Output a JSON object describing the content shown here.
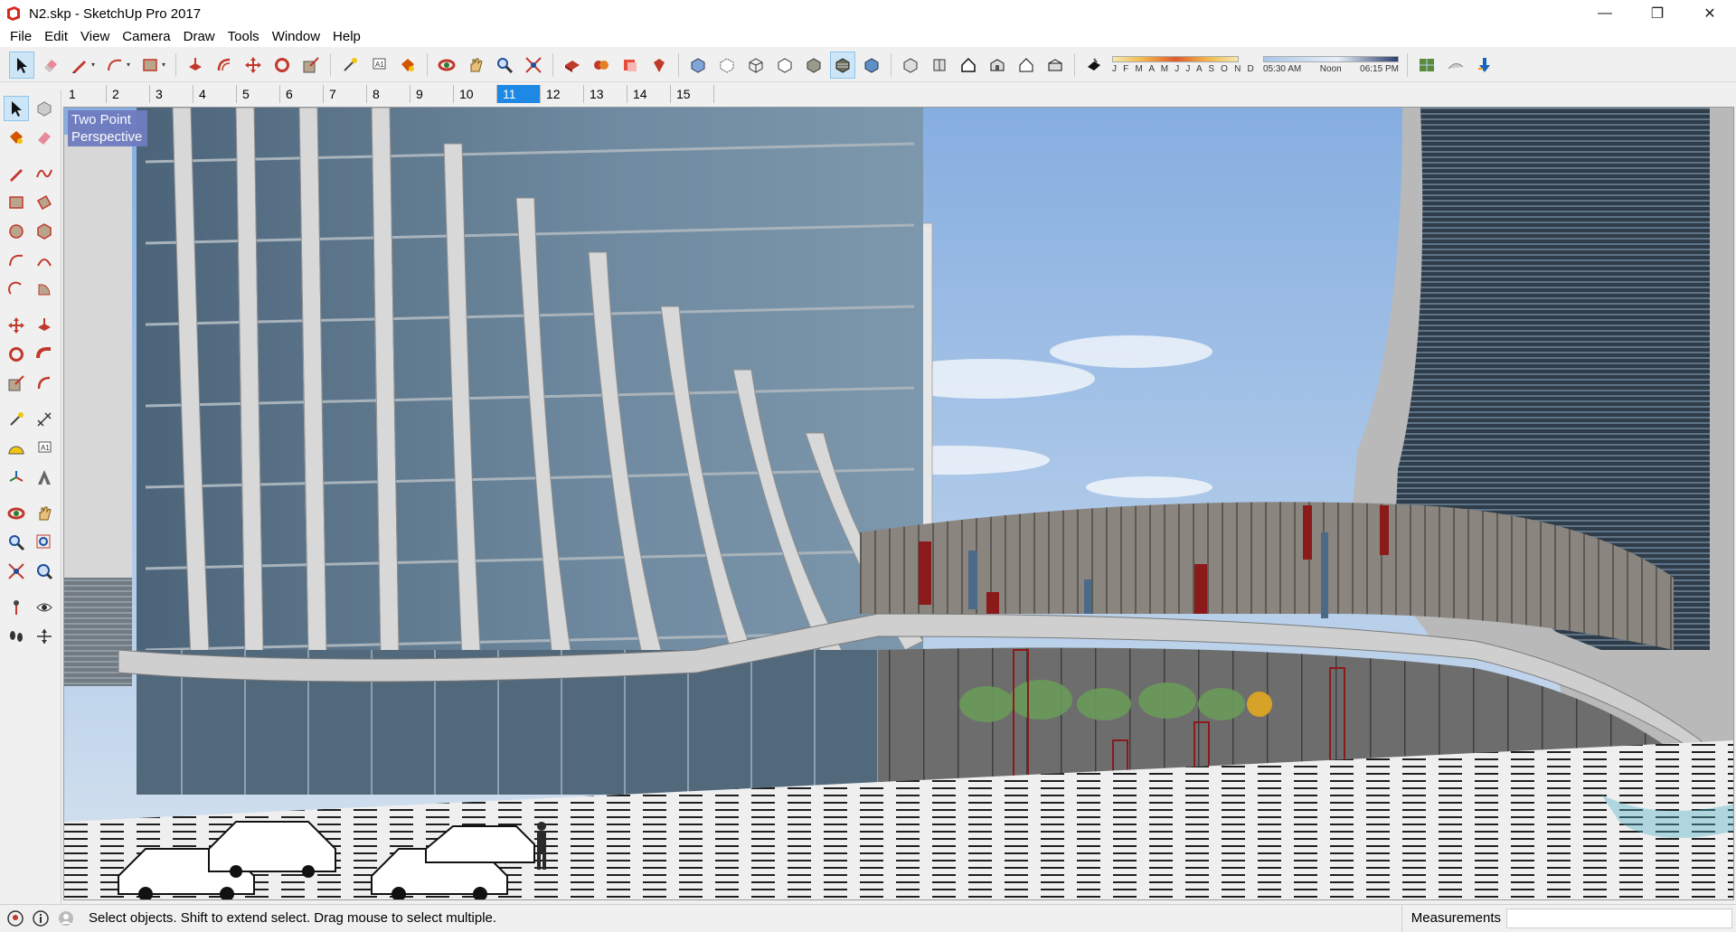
{
  "window": {
    "title": "N2.skp - SketchUp Pro 2017"
  },
  "menu": [
    "File",
    "Edit",
    "View",
    "Camera",
    "Draw",
    "Tools",
    "Window",
    "Help"
  ],
  "shadow": {
    "months_label": "J F M A M J J A S O N D",
    "time_start": "05:30 AM",
    "time_mid": "Noon",
    "time_end": "06:15 PM"
  },
  "scenes": {
    "tabs": [
      "1",
      "2",
      "3",
      "4",
      "5",
      "6",
      "7",
      "8",
      "9",
      "10",
      "11",
      "12",
      "13",
      "14",
      "15"
    ],
    "active": "11"
  },
  "viewport": {
    "camera_label": "Two Point Perspective"
  },
  "status": {
    "hint": "Select objects. Shift to extend select. Drag mouse to select multiple.",
    "measurements_label": "Measurements",
    "measurements_value": ""
  },
  "colors": {
    "accent": "#1e88e5",
    "glass": "#5f7a92",
    "sky": "#9cbde6",
    "facade_red": "#8b1a1a",
    "water": "#4fb1c8"
  },
  "icons": {
    "toolbar": [
      "select-icon",
      "eraser-icon",
      "pencil-icon",
      "arc-icon",
      "rectangle-icon",
      "push-pull-icon",
      "offset-icon",
      "move-icon",
      "rotate-icon",
      "scale-icon",
      "tape-measure-icon",
      "text-icon",
      "paint-bucket-icon",
      "orbit-icon",
      "pan-icon",
      "zoom-icon",
      "zoom-extents-icon",
      "warehouse-icon",
      "extension-warehouse-icon",
      "layout-icon",
      "ruby-icon",
      "xray-icon",
      "back-edges-icon",
      "wireframe-icon",
      "hidden-line-icon",
      "shaded-icon",
      "textured-icon",
      "monochrome-icon",
      "iso-icon",
      "top-view-icon",
      "front-view-icon",
      "right-view-icon",
      "back-view-icon",
      "left-view-icon",
      "shadow-toggle-icon",
      "geo-location-icon",
      "sandbox-icon",
      "add-location-icon"
    ]
  }
}
